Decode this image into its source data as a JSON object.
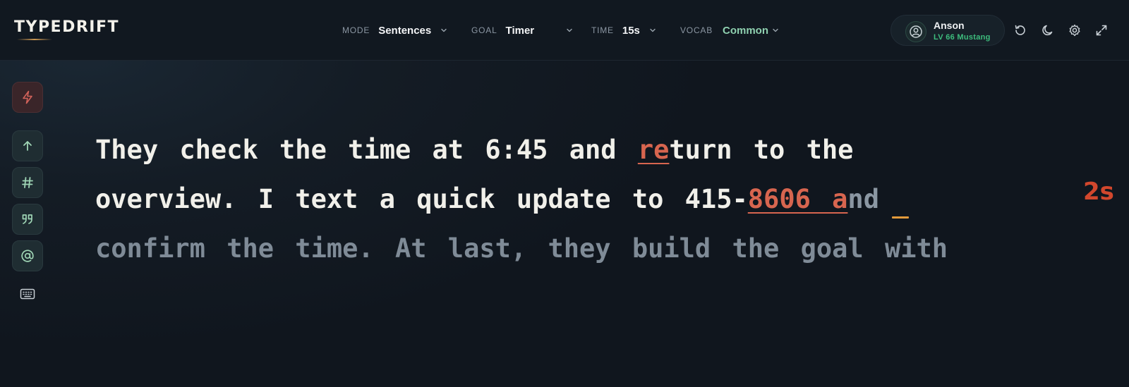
{
  "app": {
    "logo": "TYPEDRIFT"
  },
  "header": {
    "selectors": [
      {
        "key": "MODE",
        "value": "Sentences"
      },
      {
        "key": "GOAL",
        "value": "Timer"
      },
      {
        "key": "TIME",
        "value": "15s"
      },
      {
        "key": "VOCAB",
        "value": "Common"
      }
    ],
    "user": {
      "name": "Anson",
      "level": "LV 66 Mustang"
    },
    "icons": [
      "restart-icon",
      "moon-icon",
      "gear-icon",
      "expand-icon"
    ]
  },
  "rail": {
    "buttons": [
      "lightning-icon",
      "arrow-up-icon",
      "hash-icon",
      "quote-icon",
      "at-icon",
      "keyboard-icon"
    ]
  },
  "typing": {
    "line1": {
      "typed_before": "They check the time at 6:45 and ",
      "error": "re",
      "typed_after": "turn to the"
    },
    "line2": {
      "typed_before": "overview. I text a quick update to 415-",
      "error": "8606 a",
      "pending_rest": "nd"
    },
    "line3": "confirm the time. At last, they build the goal with"
  },
  "timer": "2s",
  "colors": {
    "accent_green": "#8fd1b0",
    "level_green": "#3dbd7d",
    "error_red": "#d7654f",
    "timer_red": "#d2472d",
    "caret_orange": "#e29a3b"
  }
}
